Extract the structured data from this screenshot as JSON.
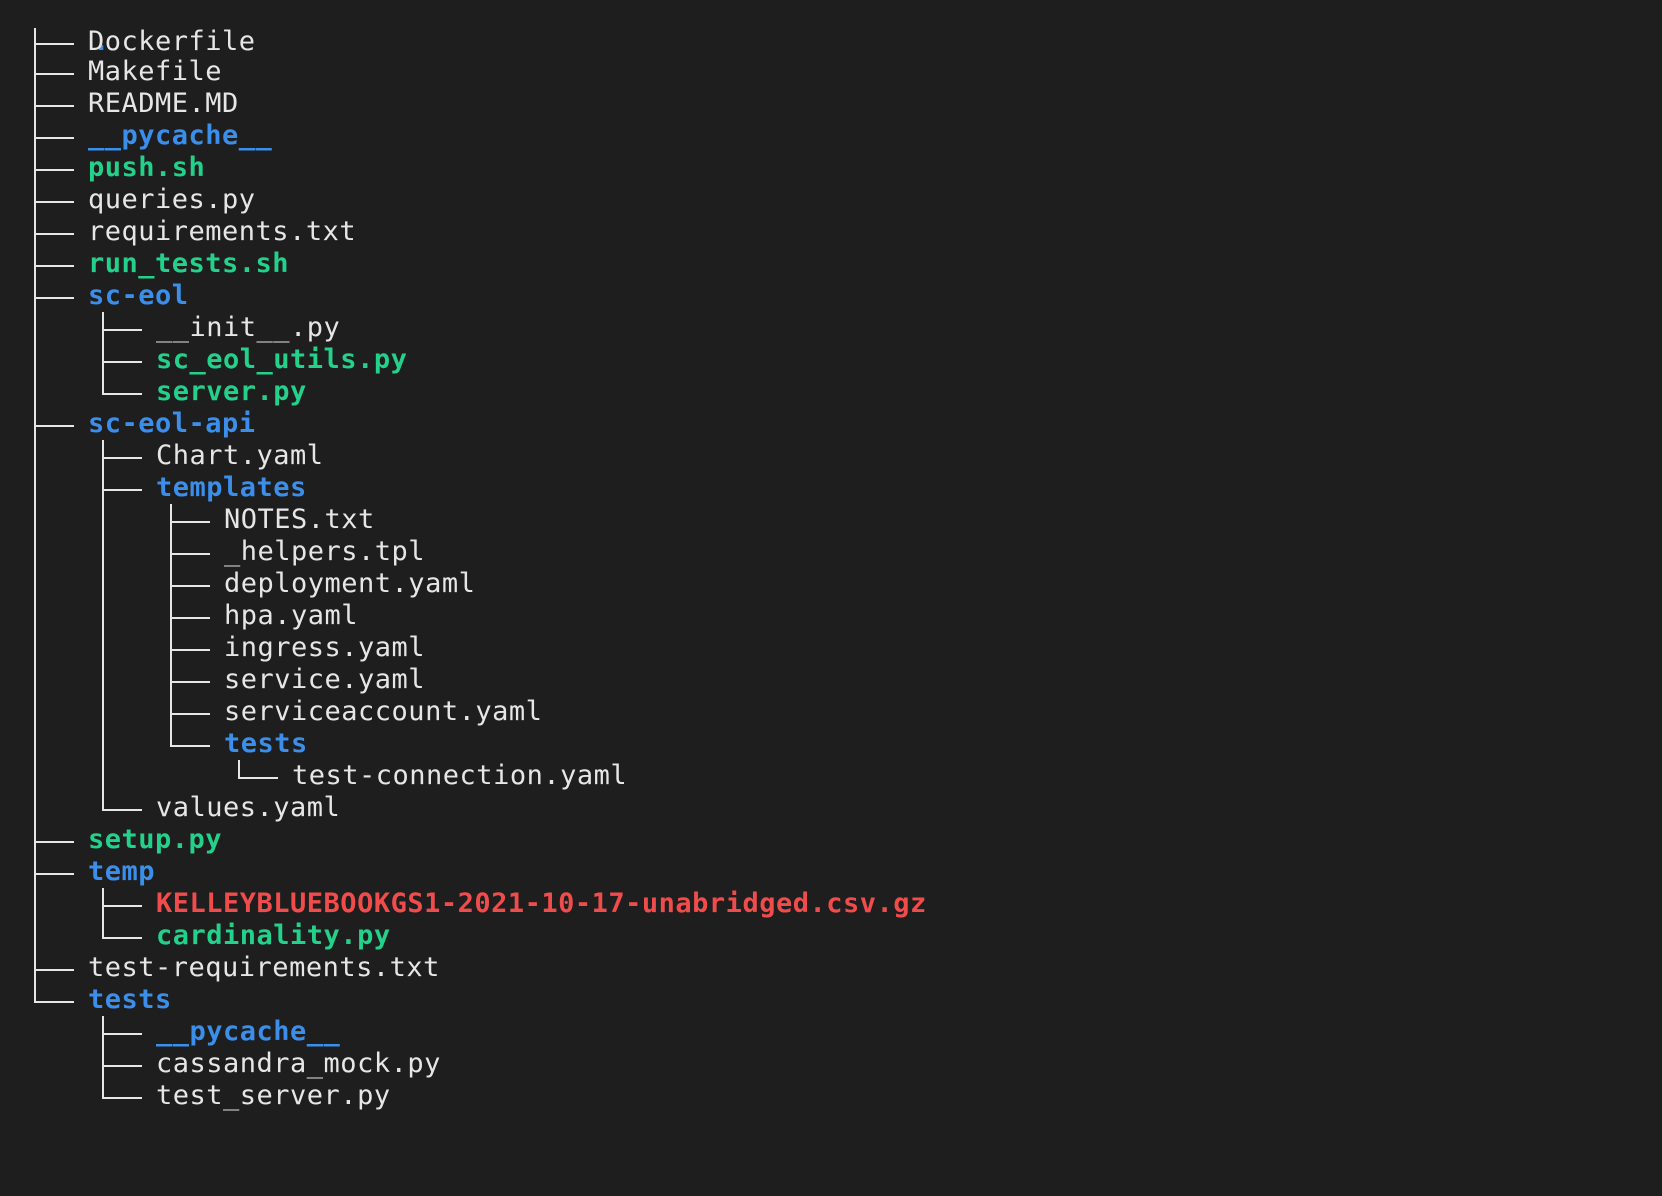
{
  "tree": {
    "root": ".",
    "entries": [
      {
        "segments": [
          "tee"
        ],
        "name": "Dockerfile",
        "kind": "file"
      },
      {
        "segments": [
          "tee"
        ],
        "name": "Makefile",
        "kind": "file"
      },
      {
        "segments": [
          "tee"
        ],
        "name": "README.MD",
        "kind": "file"
      },
      {
        "segments": [
          "tee"
        ],
        "name": "__pycache__",
        "kind": "dir"
      },
      {
        "segments": [
          "tee"
        ],
        "name": "push.sh",
        "kind": "exec"
      },
      {
        "segments": [
          "tee"
        ],
        "name": "queries.py",
        "kind": "file"
      },
      {
        "segments": [
          "tee"
        ],
        "name": "requirements.txt",
        "kind": "file"
      },
      {
        "segments": [
          "tee"
        ],
        "name": "run_tests.sh",
        "kind": "exec"
      },
      {
        "segments": [
          "tee"
        ],
        "name": "sc-eol",
        "kind": "dir"
      },
      {
        "segments": [
          "cont",
          "tee"
        ],
        "name": "__init__.py",
        "kind": "file"
      },
      {
        "segments": [
          "cont",
          "tee"
        ],
        "name": "sc_eol_utils.py",
        "kind": "exec"
      },
      {
        "segments": [
          "cont",
          "last"
        ],
        "name": "server.py",
        "kind": "exec"
      },
      {
        "segments": [
          "tee"
        ],
        "name": "sc-eol-api",
        "kind": "dir"
      },
      {
        "segments": [
          "cont",
          "tee"
        ],
        "name": "Chart.yaml",
        "kind": "file"
      },
      {
        "segments": [
          "cont",
          "tee"
        ],
        "name": "templates",
        "kind": "dir"
      },
      {
        "segments": [
          "cont",
          "cont",
          "tee"
        ],
        "name": "NOTES.txt",
        "kind": "file"
      },
      {
        "segments": [
          "cont",
          "cont",
          "tee"
        ],
        "name": "_helpers.tpl",
        "kind": "file"
      },
      {
        "segments": [
          "cont",
          "cont",
          "tee"
        ],
        "name": "deployment.yaml",
        "kind": "file"
      },
      {
        "segments": [
          "cont",
          "cont",
          "tee"
        ],
        "name": "hpa.yaml",
        "kind": "file"
      },
      {
        "segments": [
          "cont",
          "cont",
          "tee"
        ],
        "name": "ingress.yaml",
        "kind": "file"
      },
      {
        "segments": [
          "cont",
          "cont",
          "tee"
        ],
        "name": "service.yaml",
        "kind": "file"
      },
      {
        "segments": [
          "cont",
          "cont",
          "tee"
        ],
        "name": "serviceaccount.yaml",
        "kind": "file"
      },
      {
        "segments": [
          "cont",
          "cont",
          "last"
        ],
        "name": "tests",
        "kind": "dir"
      },
      {
        "segments": [
          "cont",
          "cont",
          "blank",
          "last"
        ],
        "name": "test-connection.yaml",
        "kind": "file"
      },
      {
        "segments": [
          "cont",
          "last"
        ],
        "name": "values.yaml",
        "kind": "file"
      },
      {
        "segments": [
          "tee"
        ],
        "name": "setup.py",
        "kind": "exec"
      },
      {
        "segments": [
          "tee"
        ],
        "name": "temp",
        "kind": "dir"
      },
      {
        "segments": [
          "cont",
          "tee"
        ],
        "name": "KELLEYBLUEBOOKGS1-2021-10-17-unabridged.csv.gz",
        "kind": "archive"
      },
      {
        "segments": [
          "cont",
          "last"
        ],
        "name": "cardinality.py",
        "kind": "exec"
      },
      {
        "segments": [
          "tee"
        ],
        "name": "test-requirements.txt",
        "kind": "file"
      },
      {
        "segments": [
          "last"
        ],
        "name": "tests",
        "kind": "dir"
      },
      {
        "segments": [
          "blank",
          "tee"
        ],
        "name": "__pycache__",
        "kind": "dir"
      },
      {
        "segments": [
          "blank",
          "tee"
        ],
        "name": "cassandra_mock.py",
        "kind": "file"
      },
      {
        "segments": [
          "blank",
          "last"
        ],
        "name": "test_server.py",
        "kind": "file"
      }
    ]
  },
  "colors": {
    "background": "#1e1e1e",
    "text": "#e6e6e6",
    "directory": "#3b8eea",
    "executable": "#23d18b",
    "archive": "#f14c4c"
  }
}
